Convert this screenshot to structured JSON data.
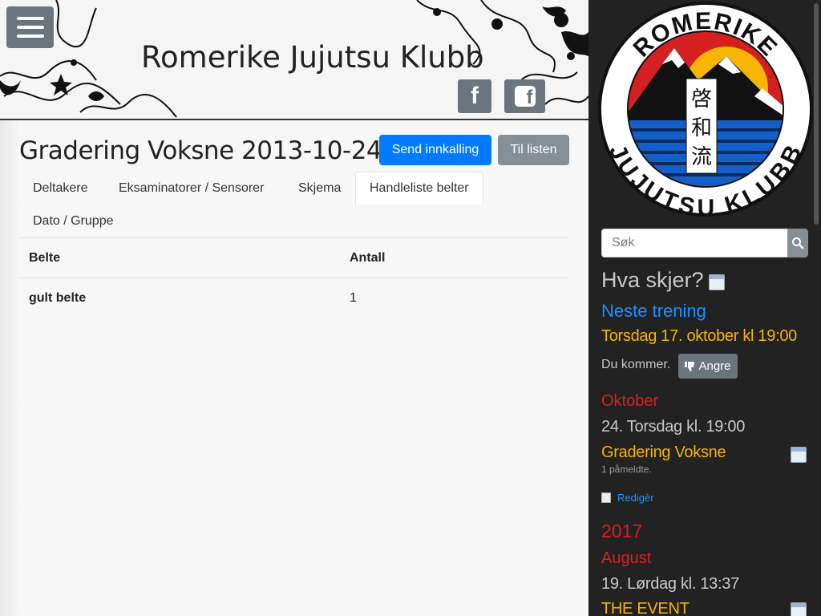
{
  "header": {
    "site_title": "Romerike Jujutsu Klubb",
    "menu_icon": "hamburger-icon",
    "social": [
      {
        "name": "facebook",
        "icon": "facebook-icon"
      },
      {
        "name": "facebook-square",
        "icon": "facebook-square-icon"
      }
    ]
  },
  "main": {
    "title": "Gradering Voksne 2013-10-24",
    "buttons": {
      "send": "Send innkalling",
      "back": "Til listen"
    },
    "tabs": [
      {
        "label": "Deltakere",
        "active": false
      },
      {
        "label": "Eksaminatorer / Sensorer",
        "active": false
      },
      {
        "label": "Skjema",
        "active": false
      },
      {
        "label": "Handleliste belter",
        "active": true
      },
      {
        "label": "Dato / Gruppe",
        "active": false
      }
    ],
    "table": {
      "headers": [
        "Belte",
        "Antall"
      ],
      "rows": [
        [
          "gult belte",
          "1"
        ]
      ]
    }
  },
  "sidebar": {
    "logo": {
      "top_text": "ROMERIKE",
      "bottom_text": "JUJUTSU KLUBB",
      "kanji": [
        "啓",
        "和",
        "流"
      ]
    },
    "search": {
      "placeholder": "Søk",
      "icon": "search-icon"
    },
    "what_heading": "Hva skjer?",
    "next_training_heading": "Neste trening",
    "next_training_time": "Torsdag 17. oktober kl 19:00",
    "attendance_text": "Du kommer.",
    "undo_label": "Angre",
    "events": {
      "month1": "Oktober",
      "date1": "24. Torsdag kl. 19:00",
      "event1": "Gradering Voksne",
      "event1_signups": "1 påmeldte.",
      "edit_label": "Redigèr",
      "year2": "2017",
      "month2": "August",
      "date2": "19. Lørdag kl. 13:37",
      "event2": "THE EVENT"
    }
  },
  "colors": {
    "primary": "#007bff",
    "secondary": "#868e96",
    "sidebar_bg": "#222222",
    "accent_yellow": "#f5b400",
    "accent_red": "#dc1f1f",
    "accent_blue": "#1e90ff"
  }
}
